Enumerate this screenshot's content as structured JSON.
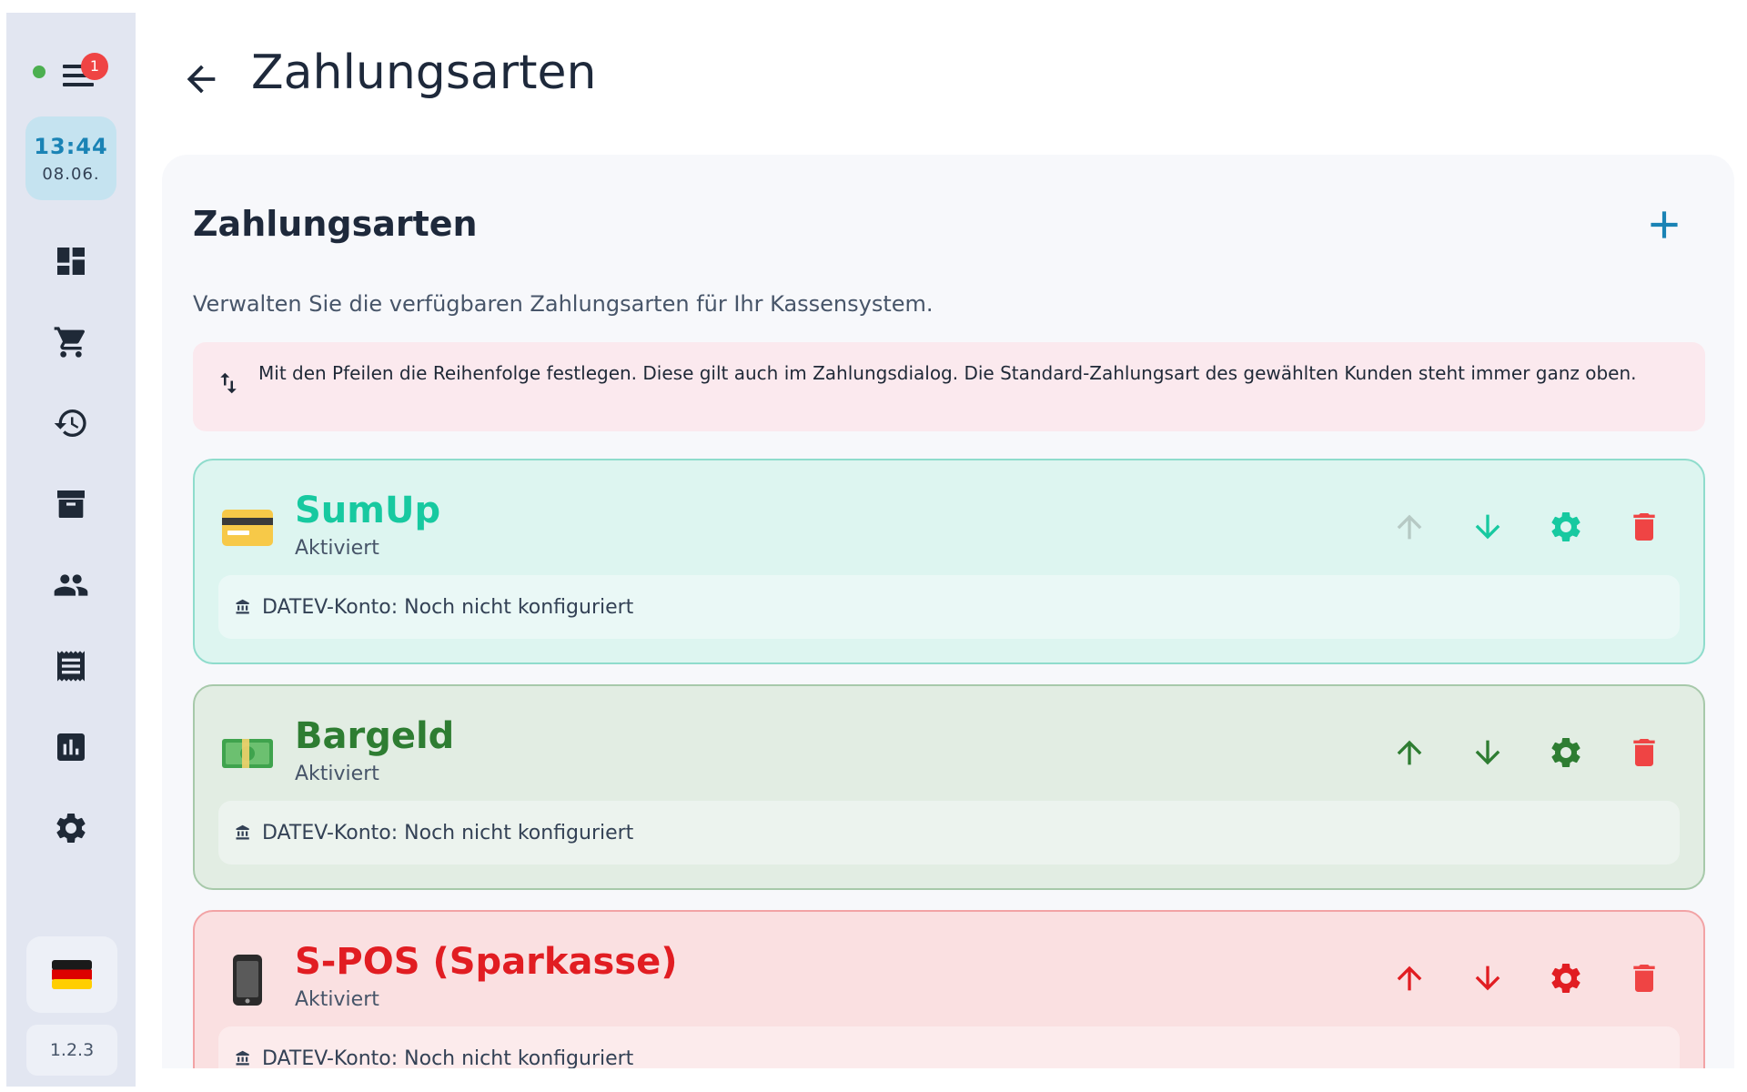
{
  "sidebar": {
    "notification_count": "1",
    "clock": {
      "time": "13:44",
      "date": "08.06."
    },
    "nav": [
      {
        "id": "dashboard",
        "icon": "dashboard-icon"
      },
      {
        "id": "cart",
        "icon": "cart-icon"
      },
      {
        "id": "history",
        "icon": "history-icon"
      },
      {
        "id": "archive",
        "icon": "archive-icon"
      },
      {
        "id": "customers",
        "icon": "people-icon"
      },
      {
        "id": "receipts",
        "icon": "receipt-icon"
      },
      {
        "id": "reports",
        "icon": "bar-chart-icon"
      },
      {
        "id": "settings",
        "icon": "gear-icon"
      }
    ],
    "language_flag": "🇩🇪",
    "version": "1.2.3",
    "status_color": "#4caf50"
  },
  "header": {
    "title": "Zahlungsarten"
  },
  "panel": {
    "title": "Zahlungsarten",
    "description": "Verwalten Sie die verfügbaren Zahlungsarten für Ihr Kassensystem.",
    "hint": "Mit den Pfeilen die Reihenfolge festlegen. Diese gilt auch im Zahlungsdialog. Die Standard-Zahlungsart des gewählten Kunden steht immer ganz oben."
  },
  "payment_methods": [
    {
      "name": "SumUp",
      "status": "Aktiviert",
      "emoji": "💳",
      "datev": "DATEV-Konto: Noch nicht konfiguriert",
      "color": "#17c9a0",
      "up_enabled": false
    },
    {
      "name": "Bargeld",
      "status": "Aktiviert",
      "emoji": "💵",
      "datev": "DATEV-Konto: Noch nicht konfiguriert",
      "color": "#2e7d32",
      "up_enabled": true
    },
    {
      "name": "S-POS (Sparkasse)",
      "status": "Aktiviert",
      "emoji": "📱",
      "datev": "DATEV-Konto: Noch nicht konfiguriert",
      "color": "#e11d22",
      "up_enabled": true
    }
  ],
  "colors": {
    "delete": "#ef4444",
    "accent": "#1a83b5",
    "disabled": "#b6c9c4"
  }
}
